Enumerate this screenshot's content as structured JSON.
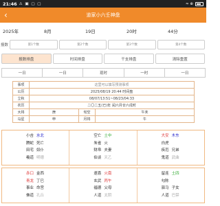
{
  "status": {
    "time": "21:46",
    "icons": "⚠ ▣ ▢ ▢",
    "net": "≈ ⊕",
    "battery_label": "battery"
  },
  "app": {
    "title": "道家小六壬神盘",
    "back": "‹"
  },
  "date": {
    "year": "2025年",
    "month": "8月",
    "day": "19日",
    "hour": "20时",
    "minute": "44分"
  },
  "numbers": {
    "label": "报数",
    "placeholders": [
      "第1个数",
      "第2个数",
      "第3个数",
      "第4个数"
    ]
  },
  "buttons": [
    {
      "label": "报数排盘",
      "active": true
    },
    {
      "label": "时间排盘",
      "active": false
    },
    {
      "label": "干支排盘",
      "active": false
    },
    {
      "label": "清除重置",
      "active": false
    }
  ],
  "shift": [
    "一日",
    "一日",
    "现时",
    "一时",
    "一日"
  ],
  "info": {
    "event_label": "事项",
    "event_hint": "这里可以填写预测事项",
    "gregorian_label": "公历",
    "gregorian_value": "2025/08/19 20:44 时间盘",
    "term_label": "立秋",
    "term_value": "08/07/13:51~08/23/04:33",
    "lunar_label": "农历",
    "lunar_value": "二〇二五(已)年 闰六月廿六戌时",
    "dayun_label": "大将",
    "dayun_value": "庚",
    "xunkong_label": "旬空",
    "xunkong_value": "午未",
    "mastar_label": "马星",
    "mastar_value": "申",
    "yuejiang_label": "月将",
    "yuejiang_value": "午"
  },
  "pan": [
    [
      {
        "c1": "小吉",
        "c2": "水北",
        "c2c": "b"
      },
      {
        "c1": "腾蛇",
        "c2": "死亡"
      },
      {
        "c1": "田宅",
        "c2": "奴仆"
      },
      {
        "c1": "羲道",
        "c2": "明德"
      },
      {
        "c1": "空亡",
        "c2": "土中",
        "c2c": "g"
      },
      {
        "c1": "朱雀",
        "c2": "火"
      },
      {
        "c1": "财帛",
        "c2": "夫妻"
      },
      {
        "c1": "伯谈",
        "c2": "天乙"
      },
      {
        "c1": "大安",
        "c2": "木东",
        "c1c": "r",
        "c2c": "b"
      },
      {
        "c1": "白虎",
        "c2": ""
      },
      {
        "c1": "疾厄",
        "c2": "兄弟"
      },
      {
        "c1": "鬼道",
        "c2": "武曲"
      }
    ],
    [
      {
        "c1": "赤口",
        "c2": "金西",
        "c1c": "r"
      },
      {
        "c1": "青龙",
        "c2": "丁巳",
        "c1c": "r"
      },
      {
        "c1": "事业",
        "c2": "命宫"
      },
      {
        "c1": "佛道",
        "c2": "孔丘"
      },
      {
        "c1": "速喜",
        "c2": "火南"
      },
      {
        "c1": "玄武",
        "c2": "丙午",
        "c2c": "r"
      },
      {
        "c1": "福德",
        "c2": "父母"
      },
      {
        "c1": "人道",
        "c2": "太阴"
      },
      {
        "c1": "留连",
        "c2": "土四",
        "c2c": "g"
      },
      {
        "c1": "勾陈",
        "c2": ""
      },
      {
        "c1": "驿马",
        "c2": "子女"
      },
      {
        "c1": "人道",
        "c2": "巴禁"
      }
    ]
  ]
}
